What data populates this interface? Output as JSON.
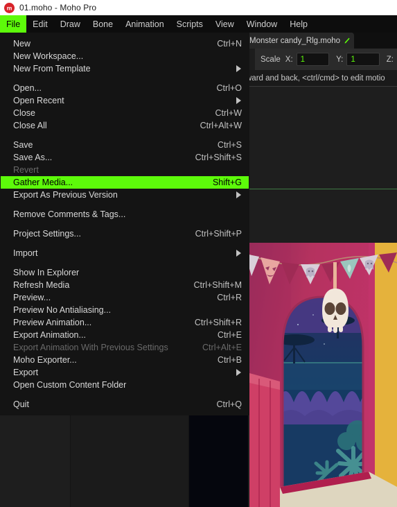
{
  "window": {
    "title": "01.moho - Moho Pro",
    "logo_icon": "moho-logo-icon"
  },
  "menubar": {
    "items": [
      {
        "label": "File",
        "active": true
      },
      {
        "label": "Edit",
        "active": false
      },
      {
        "label": "Draw",
        "active": false
      },
      {
        "label": "Bone",
        "active": false
      },
      {
        "label": "Animation",
        "active": false
      },
      {
        "label": "Scripts",
        "active": false
      },
      {
        "label": "View",
        "active": false
      },
      {
        "label": "Window",
        "active": false
      },
      {
        "label": "Help",
        "active": false
      }
    ]
  },
  "file_menu": {
    "highlight_color": "#5dfa0a",
    "groups": [
      [
        {
          "label": "New",
          "accel": "Ctrl+N",
          "submenu": false,
          "disabled": false,
          "highlight": false
        },
        {
          "label": "New Workspace...",
          "accel": "",
          "submenu": false,
          "disabled": false,
          "highlight": false
        },
        {
          "label": "New From Template",
          "accel": "",
          "submenu": true,
          "disabled": false,
          "highlight": false
        }
      ],
      [
        {
          "label": "Open...",
          "accel": "Ctrl+O",
          "submenu": false,
          "disabled": false,
          "highlight": false
        },
        {
          "label": "Open Recent",
          "accel": "",
          "submenu": true,
          "disabled": false,
          "highlight": false
        },
        {
          "label": "Close",
          "accel": "Ctrl+W",
          "submenu": false,
          "disabled": false,
          "highlight": false
        },
        {
          "label": "Close All",
          "accel": "Ctrl+Alt+W",
          "submenu": false,
          "disabled": false,
          "highlight": false
        }
      ],
      [
        {
          "label": "Save",
          "accel": "Ctrl+S",
          "submenu": false,
          "disabled": false,
          "highlight": false
        },
        {
          "label": "Save As...",
          "accel": "Ctrl+Shift+S",
          "submenu": false,
          "disabled": false,
          "highlight": false
        },
        {
          "label": "Revert",
          "accel": "",
          "submenu": false,
          "disabled": true,
          "highlight": false
        },
        {
          "label": "Gather Media...",
          "accel": "Shift+G",
          "submenu": false,
          "disabled": false,
          "highlight": true
        },
        {
          "label": "Export As Previous Version",
          "accel": "",
          "submenu": true,
          "disabled": false,
          "highlight": false
        }
      ],
      [
        {
          "label": "Remove Comments & Tags...",
          "accel": "",
          "submenu": false,
          "disabled": false,
          "highlight": false
        }
      ],
      [
        {
          "label": "Project Settings...",
          "accel": "Ctrl+Shift+P",
          "submenu": false,
          "disabled": false,
          "highlight": false
        }
      ],
      [
        {
          "label": "Import",
          "accel": "",
          "submenu": true,
          "disabled": false,
          "highlight": false
        }
      ],
      [
        {
          "label": "Show In Explorer",
          "accel": "",
          "submenu": false,
          "disabled": false,
          "highlight": false
        },
        {
          "label": "Refresh Media",
          "accel": "Ctrl+Shift+M",
          "submenu": false,
          "disabled": false,
          "highlight": false
        },
        {
          "label": "Preview...",
          "accel": "Ctrl+R",
          "submenu": false,
          "disabled": false,
          "highlight": false
        },
        {
          "label": "Preview No Antialiasing...",
          "accel": "",
          "submenu": false,
          "disabled": false,
          "highlight": false
        },
        {
          "label": "Preview Animation...",
          "accel": "Ctrl+Shift+R",
          "submenu": false,
          "disabled": false,
          "highlight": false
        },
        {
          "label": "Export Animation...",
          "accel": "Ctrl+E",
          "submenu": false,
          "disabled": false,
          "highlight": false
        },
        {
          "label": "Export Animation With Previous Settings",
          "accel": "Ctrl+Alt+E",
          "submenu": false,
          "disabled": true,
          "highlight": false
        },
        {
          "label": "Moho Exporter...",
          "accel": "Ctrl+B",
          "submenu": false,
          "disabled": false,
          "highlight": false
        },
        {
          "label": "Export",
          "accel": "",
          "submenu": true,
          "disabled": false,
          "highlight": false
        },
        {
          "label": "Open Custom Content Folder",
          "accel": "",
          "submenu": false,
          "disabled": false,
          "highlight": false
        }
      ],
      [
        {
          "label": "Quit",
          "accel": "Ctrl+Q",
          "submenu": false,
          "disabled": false,
          "highlight": false
        }
      ]
    ]
  },
  "document_tab": {
    "label": "Monster candy_Rlg.moho",
    "edit_icon": "pencil-icon"
  },
  "tool_options": {
    "tool_label": "Scale",
    "x_label": "X:",
    "x_value": "1",
    "y_label": "Y:",
    "y_value": "1",
    "z_label": "Z:",
    "value_color": "#5dfa0a"
  },
  "status_bar": {
    "message": "ward and back, <ctrl/cmd> to edit motio"
  },
  "artwork": {
    "description": "halloween-scene-bunting-skull-archway",
    "colors": {
      "wall_pink": "#c2336a",
      "wall_magenta": "#8e2b58",
      "wall_rose": "#d24a6a",
      "bunting_cream": "#d9cfd9",
      "bunting_pink": "#e8a6a0",
      "bunting_teal": "#9ac6bd",
      "skull_cream": "#f2e7db",
      "skull_socket": "#5b4437",
      "sky_navy": "#173a63",
      "sky_purple": "#4b3a86",
      "foliage_teal": "#3f8d8c",
      "yellow_post": "#e5b23c",
      "floor_sand": "#ded6bf"
    }
  }
}
